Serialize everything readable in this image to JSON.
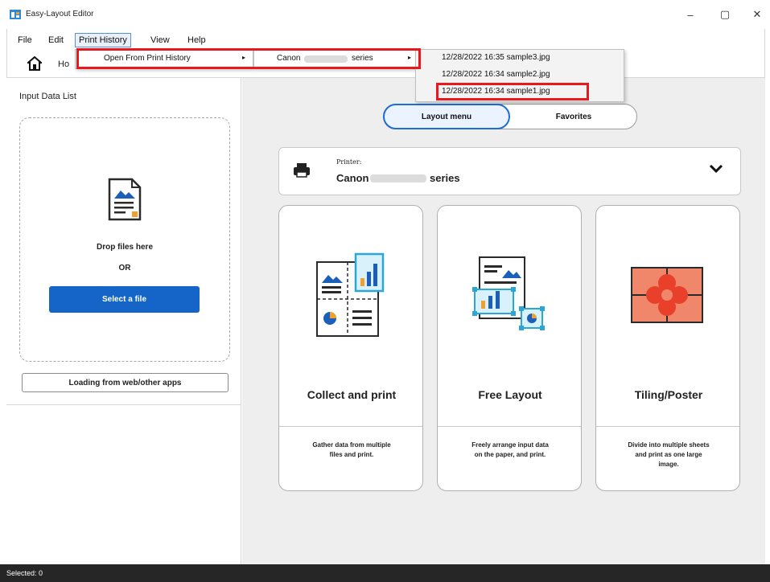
{
  "window": {
    "title": "Easy-Layout Editor",
    "minimize_glyph": "–",
    "maximize_glyph": "▢",
    "close_glyph": "✕"
  },
  "menubar": {
    "file": "File",
    "edit": "Edit",
    "print_history": "Print History",
    "view": "View",
    "help": "Help"
  },
  "toolbar": {
    "home_label": "Ho"
  },
  "menus": {
    "open_from_history": "Open From Print History",
    "printer_prefix": "Canon",
    "printer_suffix": "series",
    "history_items": [
      "12/28/2022 16:35 sample3.jpg",
      "12/28/2022 16:34 sample2.jpg",
      "12/28/2022 16:34 sample1.jpg"
    ],
    "arrow_glyph": "▸"
  },
  "left_panel": {
    "title": "Input Data List",
    "drop_text": "Drop files here",
    "or_text": "OR",
    "select_button": "Select a file",
    "loading_button": "Loading from web/other apps"
  },
  "tabs": {
    "layout_menu": "Layout menu",
    "favorites": "Favorites"
  },
  "printer": {
    "label": "Printer:",
    "name_prefix": "Canon",
    "name_suffix": "series"
  },
  "cards": [
    {
      "title": "Collect and print",
      "desc": [
        "Gather data from multiple",
        "files and print."
      ]
    },
    {
      "title": "Free Layout",
      "desc": [
        "Freely arrange input data",
        "on the paper, and print."
      ]
    },
    {
      "title": "Tiling/Poster",
      "desc": [
        "Divide into multiple sheets",
        "and print as one large",
        "image."
      ]
    }
  ],
  "status": {
    "text": "Selected: 0"
  },
  "colors": {
    "accent": "#1565c9",
    "highlight_red": "#e8181d",
    "status_bar": "#262626",
    "right_background": "#eeeeee",
    "tile_orange": "#f0876a"
  },
  "icons": {
    "app": "app-icon",
    "home": "home-icon",
    "document": "document-icon",
    "printer": "printer-icon",
    "chevron": "chevron-down-icon",
    "collect": "collect-and-print-icon",
    "free_layout": "free-layout-icon",
    "tiling": "tiling-poster-icon"
  }
}
